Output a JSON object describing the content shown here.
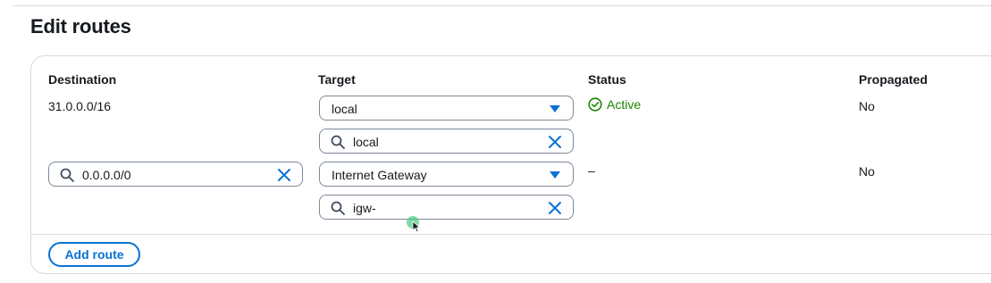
{
  "page": {
    "title": "Edit routes"
  },
  "columns": {
    "destination": "Destination",
    "target": "Target",
    "status": "Status",
    "propagated": "Propagated"
  },
  "routes": [
    {
      "destination": "31.0.0.0/16",
      "target_selected": "local",
      "target_search": "local",
      "status": "Active",
      "propagated": "No"
    },
    {
      "destination_search": "0.0.0.0/0",
      "target_selected": "Internet Gateway",
      "target_search": "igw-",
      "status": "–",
      "propagated": "No"
    }
  ],
  "actions": {
    "add_route": "Add route"
  },
  "icons": {
    "search": "search-icon",
    "caret": "caret-down-icon",
    "clear": "clear-x-icon",
    "status_ok": "check-circle-icon"
  },
  "colors": {
    "accent": "#0972d3",
    "success": "#1d8102",
    "border": "#7d8998"
  }
}
